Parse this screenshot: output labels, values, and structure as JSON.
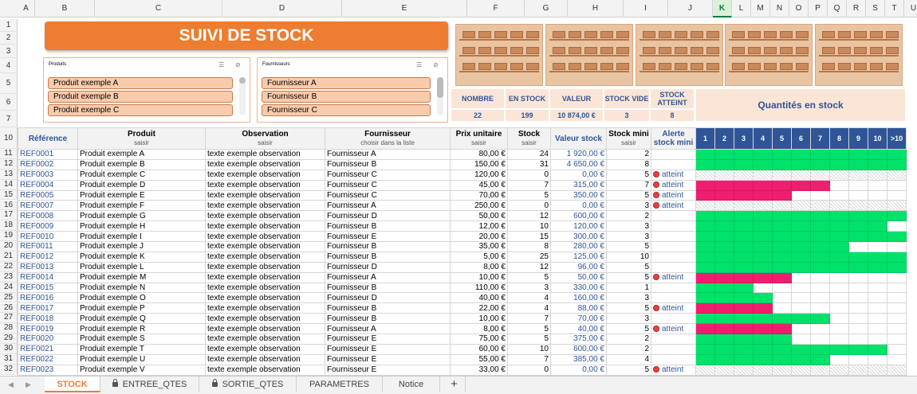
{
  "columns": [
    "A",
    "B",
    "C",
    "D",
    "E",
    "F",
    "G",
    "H",
    "I",
    "J",
    "K",
    "L",
    "M",
    "N",
    "O",
    "P",
    "Q",
    "R",
    "S",
    "T",
    "U"
  ],
  "row_numbers": [
    "1",
    "2",
    "3",
    "4",
    "5",
    "6",
    "7",
    "10",
    "11",
    "12",
    "13",
    "14",
    "15",
    "16",
    "17",
    "18",
    "19",
    "20",
    "21",
    "22",
    "23",
    "24",
    "25",
    "26",
    "27",
    "28",
    "29",
    "30",
    "31",
    "32"
  ],
  "title": "SUIVI DE STOCK",
  "slicers": {
    "produits": {
      "label": "Produits",
      "items": [
        "Produit exemple A",
        "Produit exemple B",
        "Produit exemple C"
      ]
    },
    "fournisseurs": {
      "label": "Fournisseurs",
      "items": [
        "Fournisseur A",
        "Fournisseur B",
        "Fournisseur C"
      ]
    }
  },
  "kpis": {
    "nombre": {
      "label": "NOMBRE",
      "value": "22"
    },
    "en_stock": {
      "label": "EN STOCK",
      "value": "199"
    },
    "valeur": {
      "label": "VALEUR",
      "value": "10 874,00 €"
    },
    "stock_vide": {
      "label": "STOCK VIDE",
      "value": "3"
    },
    "stock_atteint": {
      "label": "STOCK ATTEINT",
      "value": "8"
    }
  },
  "quantites_title": "Quantités en stock",
  "headers": {
    "reference": "Référence",
    "produit": "Produit",
    "produit_sub": "saisir",
    "observation": "Observation",
    "observation_sub": "saisir",
    "fournisseur": "Fournisseur",
    "fournisseur_sub": "choisir dans la liste",
    "prix": "Prix unitaire",
    "prix_sub": "saisir",
    "stock": "Stock",
    "stock_sub": "saisir",
    "valeur": "Valeur stock",
    "stock_mini": "Stock mini",
    "stock_mini_sub": "saisir",
    "alerte": "Alerte stock mini",
    "qty": [
      "1",
      "2",
      "3",
      "4",
      "5",
      "6",
      "7",
      "8",
      "9",
      "10",
      ">10"
    ]
  },
  "rows": [
    {
      "ref": "REF0001",
      "produit": "Produit exemple A",
      "obs": "texte exemple observation",
      "four": "Fournisseur A",
      "prix": "80,00 €",
      "stock": "24",
      "valeur": "1 920,00 €",
      "mini": "2",
      "alerte": "",
      "fill": "ggggggggggg"
    },
    {
      "ref": "REF0002",
      "produit": "Produit exemple B",
      "obs": "texte exemple observation",
      "four": "Fournisseur B",
      "prix": "150,00 €",
      "stock": "31",
      "valeur": "4 650,00 €",
      "mini": "8",
      "alerte": "",
      "fill": "ggggggggggg"
    },
    {
      "ref": "REF0003",
      "produit": "Produit exemple C",
      "obs": "texte exemple observation",
      "four": "Fournisseur C",
      "prix": "120,00 €",
      "stock": "0",
      "valeur": "0,00 €",
      "mini": "5",
      "alerte": "atteint",
      "fill": "hhhhhhhhhhh"
    },
    {
      "ref": "REF0004",
      "produit": "Produit exemple D",
      "obs": "texte exemple observation",
      "four": "Fournisseur C",
      "prix": "45,00 €",
      "stock": "7",
      "valeur": "315,00 €",
      "mini": "7",
      "alerte": "atteint",
      "fill": "rrrrrrr...."
    },
    {
      "ref": "REF0005",
      "produit": "Produit exemple E",
      "obs": "texte exemple observation",
      "four": "Fournisseur C",
      "prix": "70,00 €",
      "stock": "5",
      "valeur": "350,00 €",
      "mini": "5",
      "alerte": "atteint",
      "fill": "rrrrr......"
    },
    {
      "ref": "REF0007",
      "produit": "Produit exemple F",
      "obs": "texte exemple observation",
      "four": "Fournisseur A",
      "prix": "250,00 €",
      "stock": "0",
      "valeur": "0,00 €",
      "mini": "3",
      "alerte": "atteint",
      "fill": "hhhhhhhhhhh"
    },
    {
      "ref": "REF0008",
      "produit": "Produit exemple G",
      "obs": "texte exemple observation",
      "four": "Fournisseur D",
      "prix": "50,00 €",
      "stock": "12",
      "valeur": "600,00 €",
      "mini": "2",
      "alerte": "",
      "fill": "ggggggggggg"
    },
    {
      "ref": "REF0009",
      "produit": "Produit exemple H",
      "obs": "texte exemple observation",
      "four": "Fournisseur B",
      "prix": "12,00 €",
      "stock": "10",
      "valeur": "120,00 €",
      "mini": "3",
      "alerte": "",
      "fill": "gggggggggg."
    },
    {
      "ref": "REF0010",
      "produit": "Produit exemple I",
      "obs": "texte exemple observation",
      "four": "Fournisseur E",
      "prix": "20,00 €",
      "stock": "15",
      "valeur": "300,00 €",
      "mini": "3",
      "alerte": "",
      "fill": "ggggggggggg"
    },
    {
      "ref": "REF0011",
      "produit": "Produit exemple J",
      "obs": "texte exemple observation",
      "four": "Fournisseur B",
      "prix": "35,00 €",
      "stock": "8",
      "valeur": "280,00 €",
      "mini": "5",
      "alerte": "",
      "fill": "gggggggg..."
    },
    {
      "ref": "REF0012",
      "produit": "Produit exemple K",
      "obs": "texte exemple observation",
      "four": "Fournisseur B",
      "prix": "5,00 €",
      "stock": "25",
      "valeur": "125,00 €",
      "mini": "10",
      "alerte": "",
      "fill": "ggggggggggg"
    },
    {
      "ref": "REF0013",
      "produit": "Produit exemple L",
      "obs": "texte exemple observation",
      "four": "Fournisseur D",
      "prix": "8,00 €",
      "stock": "12",
      "valeur": "96,00 €",
      "mini": "5",
      "alerte": "",
      "fill": "ggggggggggg"
    },
    {
      "ref": "REF0014",
      "produit": "Produit exemple M",
      "obs": "texte exemple observation",
      "four": "Fournisseur A",
      "prix": "10,00 €",
      "stock": "5",
      "valeur": "50,00 €",
      "mini": "5",
      "alerte": "atteint",
      "fill": "rrrrr......"
    },
    {
      "ref": "REF0015",
      "produit": "Produit exemple N",
      "obs": "texte exemple observation",
      "four": "Fournisseur B",
      "prix": "110,00 €",
      "stock": "3",
      "valeur": "330,00 €",
      "mini": "1",
      "alerte": "",
      "fill": "ggg........"
    },
    {
      "ref": "REF0016",
      "produit": "Produit exemple O",
      "obs": "texte exemple observation",
      "four": "Fournisseur D",
      "prix": "40,00 €",
      "stock": "4",
      "valeur": "160,00 €",
      "mini": "3",
      "alerte": "",
      "fill": "gggg......."
    },
    {
      "ref": "REF0017",
      "produit": "Produit exemple P",
      "obs": "texte exemple observation",
      "four": "Fournisseur B",
      "prix": "22,00 €",
      "stock": "4",
      "valeur": "88,00 €",
      "mini": "5",
      "alerte": "atteint",
      "fill": "rrrr......."
    },
    {
      "ref": "REF0018",
      "produit": "Produit exemple Q",
      "obs": "texte exemple observation",
      "four": "Fournisseur B",
      "prix": "10,00 €",
      "stock": "7",
      "valeur": "70,00 €",
      "mini": "3",
      "alerte": "",
      "fill": "ggggggg...."
    },
    {
      "ref": "REF0019",
      "produit": "Produit exemple R",
      "obs": "texte exemple observation",
      "four": "Fournisseur A",
      "prix": "8,00 €",
      "stock": "5",
      "valeur": "40,00 €",
      "mini": "5",
      "alerte": "atteint",
      "fill": "rrrrr......"
    },
    {
      "ref": "REF0020",
      "produit": "Produit exemple S",
      "obs": "texte exemple observation",
      "four": "Fournisseur E",
      "prix": "75,00 €",
      "stock": "5",
      "valeur": "375,00 €",
      "mini": "2",
      "alerte": "",
      "fill": "ggggg......"
    },
    {
      "ref": "REF0021",
      "produit": "Produit exemple T",
      "obs": "texte exemple observation",
      "four": "Fournisseur E",
      "prix": "60,00 €",
      "stock": "10",
      "valeur": "600,00 €",
      "mini": "2",
      "alerte": "",
      "fill": "gggggggggg."
    },
    {
      "ref": "REF0022",
      "produit": "Produit exemple U",
      "obs": "texte exemple observation",
      "four": "Fournisseur E",
      "prix": "55,00 €",
      "stock": "7",
      "valeur": "385,00 €",
      "mini": "4",
      "alerte": "",
      "fill": "ggggggg...."
    },
    {
      "ref": "REF0023",
      "produit": "Produit exemple V",
      "obs": "texte exemple observation",
      "four": "Fournisseur E",
      "prix": "33,00 €",
      "stock": "0",
      "valeur": "0,00 €",
      "mini": "5",
      "alerte": "atteint",
      "fill": "hhhhhhhhhhh"
    }
  ],
  "tabs": [
    "STOCK",
    "ENTREE_QTES",
    "SORTIE_QTES",
    "PARAMETRES",
    "Notice"
  ],
  "tab_add": "+",
  "colors": {
    "accent": "#ed7d31",
    "kpi_bg": "#fbe5d6",
    "kpi_text": "#2f5597",
    "qty_ok": "#00e26a",
    "qty_alert": "#f01e6e"
  }
}
